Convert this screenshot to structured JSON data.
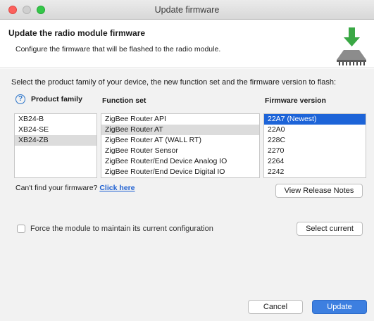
{
  "window": {
    "title": "Update firmware"
  },
  "header": {
    "title": "Update the radio module firmware",
    "subtitle": "Configure the firmware that will be flashed to the radio module."
  },
  "instruction": "Select the product family of your device, the new function set and the firmware version to flash:",
  "product_family": {
    "header": "Product family",
    "items": [
      "XB24-B",
      "XB24-SE",
      "XB24-ZB"
    ],
    "selected": "XB24-ZB"
  },
  "function_set": {
    "header": "Function set",
    "items": [
      "ZigBee Router API",
      "ZigBee Router AT",
      "ZigBee Router AT (WALL RT)",
      "ZigBee Router Sensor",
      "ZigBee Router/End Device Analog IO",
      "ZigBee Router/End Device Digital IO"
    ],
    "selected": "ZigBee Router AT"
  },
  "firmware_version": {
    "header": "Firmware version",
    "items": [
      "22A7 (Newest)",
      "22A0",
      "228C",
      "2270",
      "2264",
      "2242"
    ],
    "selected": "22A7 (Newest)"
  },
  "cant_find": {
    "text": "Can't find your firmware?",
    "link": "Click here"
  },
  "buttons": {
    "view_release_notes": "View Release Notes",
    "select_current": "Select current",
    "cancel": "Cancel",
    "update": "Update"
  },
  "force_checkbox": {
    "label": "Force the module to maintain its current configuration",
    "checked": false
  },
  "colors": {
    "selection_blue": "#1d64d8",
    "primary_button": "#3d7fe0",
    "close": "#fc605c",
    "zoom": "#34c749"
  },
  "icons": [
    "help-icon",
    "firmware-download-icon"
  ]
}
